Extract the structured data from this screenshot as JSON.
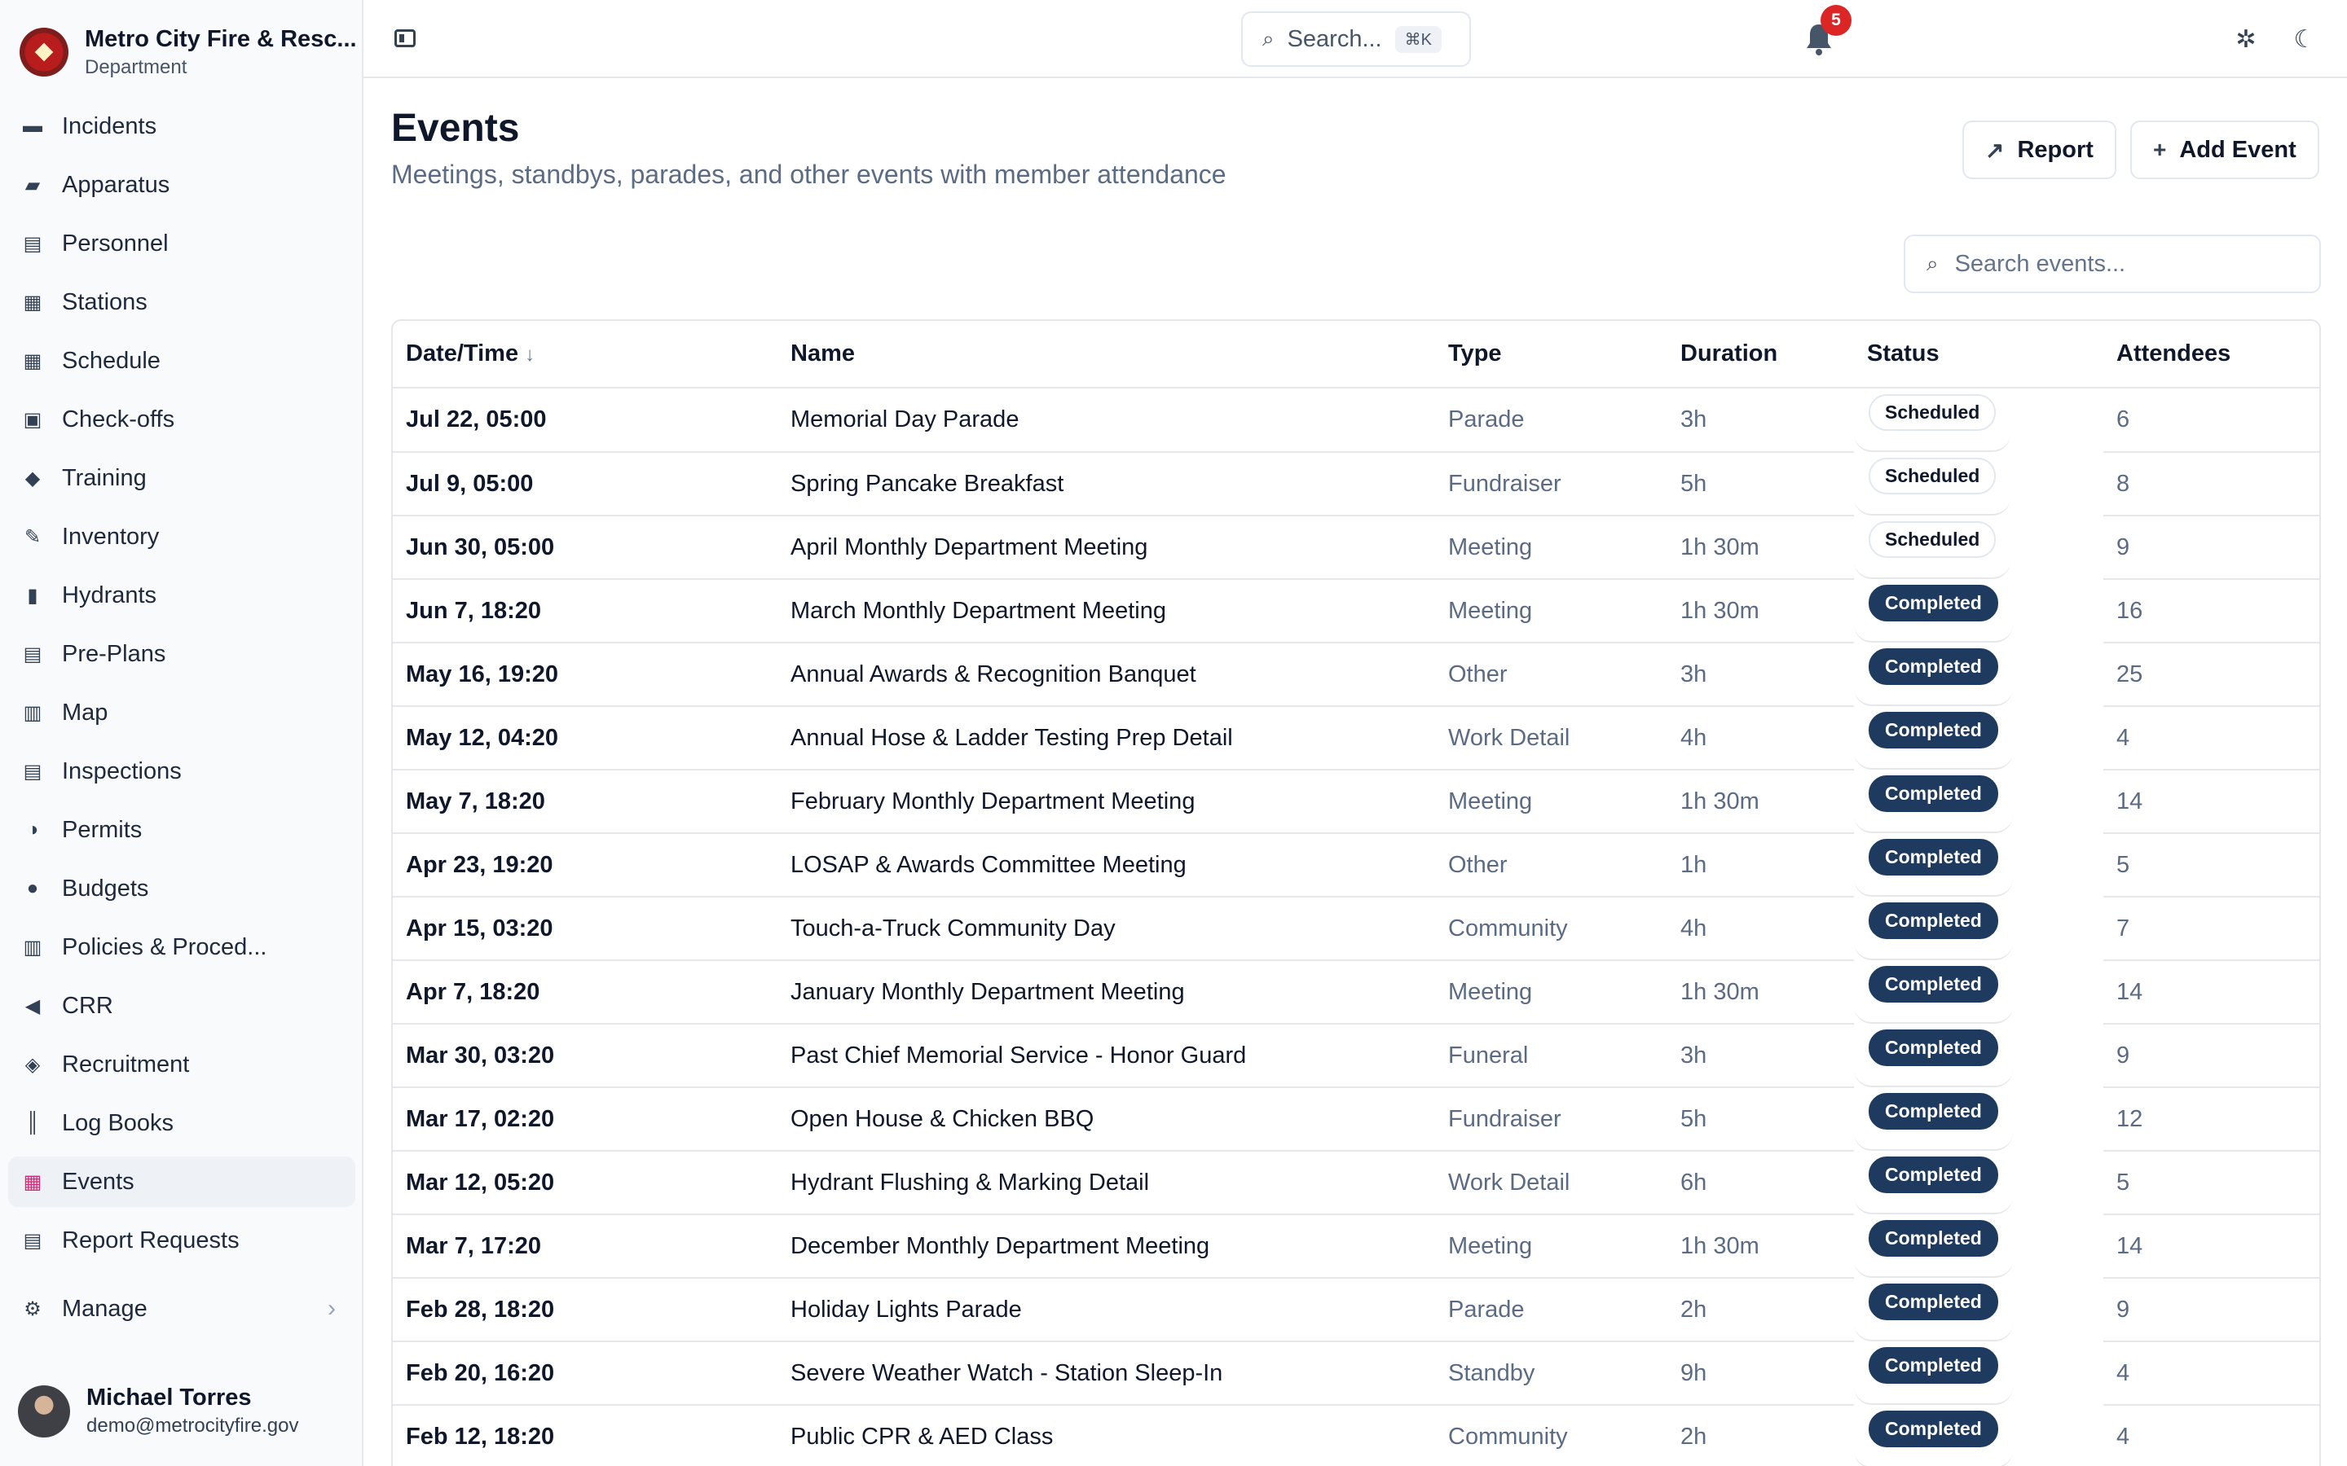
{
  "brand": {
    "name": "Metro City Fire & Resc...",
    "subtitle": "Department"
  },
  "nav": [
    {
      "label": "Incidents",
      "icon": "incidents-icon",
      "glyph": "▬",
      "active": false
    },
    {
      "label": "Apparatus",
      "icon": "fire-truck-icon",
      "glyph": "▰",
      "active": false
    },
    {
      "label": "Personnel",
      "icon": "id-card-icon",
      "glyph": "▤",
      "active": false
    },
    {
      "label": "Stations",
      "icon": "building-icon",
      "glyph": "▦",
      "active": false
    },
    {
      "label": "Schedule",
      "icon": "calendar-icon",
      "glyph": "▦",
      "active": false
    },
    {
      "label": "Check-offs",
      "icon": "clipboard-icon",
      "glyph": "▣",
      "active": false
    },
    {
      "label": "Training",
      "icon": "graduation-cap-icon",
      "glyph": "◆",
      "active": false
    },
    {
      "label": "Inventory",
      "icon": "wrench-icon",
      "glyph": "✎",
      "active": false
    },
    {
      "label": "Hydrants",
      "icon": "hydrant-icon",
      "glyph": "▮",
      "active": false
    },
    {
      "label": "Pre-Plans",
      "icon": "file-search-icon",
      "glyph": "▤",
      "active": false
    },
    {
      "label": "Map",
      "icon": "map-icon",
      "glyph": "▥",
      "active": false
    },
    {
      "label": "Inspections",
      "icon": "clipboard-check-icon",
      "glyph": "▤",
      "active": false
    },
    {
      "label": "Permits",
      "icon": "permit-icon",
      "glyph": "◑",
      "active": false
    },
    {
      "label": "Budgets",
      "icon": "piggy-bank-icon",
      "glyph": "●",
      "active": false
    },
    {
      "label": "Policies & Proced...",
      "icon": "book-icon",
      "glyph": "▥",
      "active": false
    },
    {
      "label": "CRR",
      "icon": "megaphone-icon",
      "glyph": "◀",
      "active": false
    },
    {
      "label": "Recruitment",
      "icon": "handshake-icon",
      "glyph": "◈",
      "active": false
    },
    {
      "label": "Log Books",
      "icon": "books-icon",
      "glyph": "║",
      "active": false
    },
    {
      "label": "Events",
      "icon": "calendar-event-icon",
      "glyph": "▦",
      "active": true
    },
    {
      "label": "Report Requests",
      "icon": "report-icon",
      "glyph": "▤",
      "active": false
    }
  ],
  "manage": {
    "label": "Manage",
    "icon": "gear-icon"
  },
  "user": {
    "name": "Michael Torres",
    "email": "demo@metrocityfire.gov"
  },
  "topbar": {
    "search_placeholder": "Search...",
    "search_shortcut": "⌘K",
    "notification_count": "5"
  },
  "page": {
    "title": "Events",
    "subtitle": "Meetings, standbys, parades, and other events with member attendance",
    "report_button": "Report",
    "add_button": "Add Event",
    "search_placeholder": "Search events..."
  },
  "table": {
    "columns": [
      "Date/Time",
      "Name",
      "Type",
      "Duration",
      "Status",
      "Attendees"
    ],
    "rows": [
      {
        "date": "Jul 22, 05:00",
        "name": "Memorial Day Parade",
        "type": "Parade",
        "duration": "3h",
        "status": "Scheduled",
        "attendees": "6"
      },
      {
        "date": "Jul 9, 05:00",
        "name": "Spring Pancake Breakfast",
        "type": "Fundraiser",
        "duration": "5h",
        "status": "Scheduled",
        "attendees": "8"
      },
      {
        "date": "Jun 30, 05:00",
        "name": "April Monthly Department Meeting",
        "type": "Meeting",
        "duration": "1h 30m",
        "status": "Scheduled",
        "attendees": "9"
      },
      {
        "date": "Jun 7, 18:20",
        "name": "March Monthly Department Meeting",
        "type": "Meeting",
        "duration": "1h 30m",
        "status": "Completed",
        "attendees": "16"
      },
      {
        "date": "May 16, 19:20",
        "name": "Annual Awards & Recognition Banquet",
        "type": "Other",
        "duration": "3h",
        "status": "Completed",
        "attendees": "25"
      },
      {
        "date": "May 12, 04:20",
        "name": "Annual Hose & Ladder Testing Prep Detail",
        "type": "Work Detail",
        "duration": "4h",
        "status": "Completed",
        "attendees": "4"
      },
      {
        "date": "May 7, 18:20",
        "name": "February Monthly Department Meeting",
        "type": "Meeting",
        "duration": "1h 30m",
        "status": "Completed",
        "attendees": "14"
      },
      {
        "date": "Apr 23, 19:20",
        "name": "LOSAP & Awards Committee Meeting",
        "type": "Other",
        "duration": "1h",
        "status": "Completed",
        "attendees": "5"
      },
      {
        "date": "Apr 15, 03:20",
        "name": "Touch-a-Truck Community Day",
        "type": "Community",
        "duration": "4h",
        "status": "Completed",
        "attendees": "7"
      },
      {
        "date": "Apr 7, 18:20",
        "name": "January Monthly Department Meeting",
        "type": "Meeting",
        "duration": "1h 30m",
        "status": "Completed",
        "attendees": "14"
      },
      {
        "date": "Mar 30, 03:20",
        "name": "Past Chief Memorial Service - Honor Guard",
        "type": "Funeral",
        "duration": "3h",
        "status": "Completed",
        "attendees": "9"
      },
      {
        "date": "Mar 17, 02:20",
        "name": "Open House & Chicken BBQ",
        "type": "Fundraiser",
        "duration": "5h",
        "status": "Completed",
        "attendees": "12"
      },
      {
        "date": "Mar 12, 05:20",
        "name": "Hydrant Flushing & Marking Detail",
        "type": "Work Detail",
        "duration": "6h",
        "status": "Completed",
        "attendees": "5"
      },
      {
        "date": "Mar 7, 17:20",
        "name": "December Monthly Department Meeting",
        "type": "Meeting",
        "duration": "1h 30m",
        "status": "Completed",
        "attendees": "14"
      },
      {
        "date": "Feb 28, 18:20",
        "name": "Holiday Lights Parade",
        "type": "Parade",
        "duration": "2h",
        "status": "Completed",
        "attendees": "9"
      },
      {
        "date": "Feb 20, 16:20",
        "name": "Severe Weather Watch - Station Sleep-In",
        "type": "Standby",
        "duration": "9h",
        "status": "Completed",
        "attendees": "4"
      },
      {
        "date": "Feb 12, 18:20",
        "name": "Public CPR & AED Class",
        "type": "Community",
        "duration": "2h",
        "status": "Completed",
        "attendees": "4"
      }
    ]
  }
}
